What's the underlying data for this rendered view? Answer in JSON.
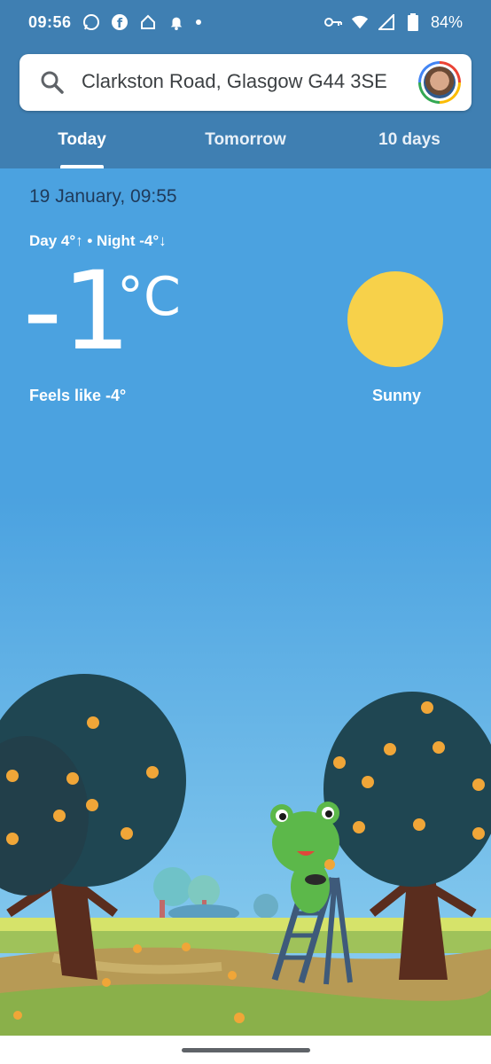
{
  "status_bar": {
    "time": "09:56",
    "battery": "84%",
    "icons_left": [
      "whatsapp-icon",
      "facebook-icon",
      "home-icon",
      "notification-bell-icon",
      "dot-icon"
    ],
    "icons_right": [
      "vpn-key-icon",
      "wifi-icon",
      "signal-icon",
      "battery-icon"
    ]
  },
  "search": {
    "location": "Clarkston Road, Glasgow G44 3SE"
  },
  "tabs": [
    {
      "label": "Today",
      "selected": true
    },
    {
      "label": "Tomorrow",
      "selected": false
    },
    {
      "label": "10 days",
      "selected": false
    }
  ],
  "weather": {
    "datetime": "19 January, 09:55",
    "day_night": "Day 4°↑ • Night -4°↓",
    "temperature": "-1",
    "unit": "°C",
    "feels_like": "Feels like -4°",
    "condition": "Sunny"
  },
  "colors": {
    "header": "#3f7fb2",
    "sky": "#4ba2e0",
    "sun": "#f7d14a"
  }
}
